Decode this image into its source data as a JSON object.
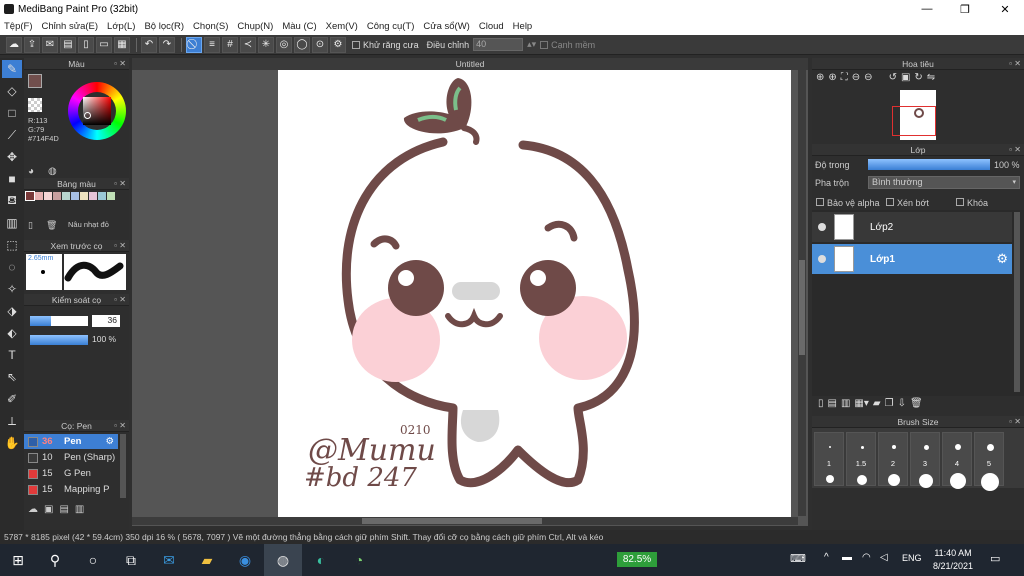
{
  "window": {
    "title": "MediBang Paint Pro (32bit)"
  },
  "menu": [
    "Tệp(F)",
    "Chỉnh sửa(E)",
    "Lớp(L)",
    "Bộ lọc(R)",
    "Chọn(S)",
    "Chụp(N)",
    "Màu (C)",
    "Xem(V)",
    "Công cụ(T)",
    "Cửa sổ(W)",
    "Cloud",
    "Help"
  ],
  "toolbar": {
    "antialias_label": "Khử răng cưa",
    "adjust_label": "Điều chỉnh",
    "adjust_value": "40",
    "edge_label": "Cạnh mềm"
  },
  "color_panel": {
    "title": "Màu",
    "r": "R:113",
    "g": "G:79",
    "hex": "#714F4D",
    "current_color": "#714f4d"
  },
  "palette_panel": {
    "title": "Bảng màu",
    "swatches": [
      "#7a3a3a",
      "#e9b3b3",
      "#f7d6d6",
      "#c9a0a0",
      "#b9d6cf",
      "#a7c0e6",
      "#efe3c0",
      "#e6c5d8",
      "#9bc9d6",
      "#c0e0b6"
    ],
    "selected_name": "Nâu nhạt đỏ"
  },
  "brush_preview": {
    "title": "Xem trước cọ",
    "size": "2.65mm"
  },
  "brush_control": {
    "title": "Kiểm soát cọ",
    "size": "36",
    "opacity": "100 %",
    "size_fraction": 0.36,
    "opacity_fraction": 1.0
  },
  "brush_list": {
    "title": "Cọ: Pen",
    "items": [
      {
        "size": "36",
        "name": "Pen",
        "color": "#3a7fd4",
        "selected": true
      },
      {
        "size": "10",
        "name": "Pen (Sharp)",
        "color": "#3a3a3a",
        "selected": false
      },
      {
        "size": "15",
        "name": "G Pen",
        "color": "#e03a3a",
        "selected": false
      },
      {
        "size": "15",
        "name": "Mapping P",
        "color": "#e03a3a",
        "selected": false
      }
    ]
  },
  "canvas": {
    "tab": "Untitled",
    "signature_line1": "@Mumu",
    "signature_line2": "#bd 247",
    "signature_note": "0210"
  },
  "navigator": {
    "title": "Hoa tiêu"
  },
  "layer_panel": {
    "title": "Lớp",
    "opacity_label": "Độ trong",
    "opacity_value": "100 %",
    "opacity_fraction": 1.0,
    "blend_label": "Pha trộn",
    "blend_value": "Bình thường",
    "protect_alpha": "Bảo vệ alpha",
    "clipping": "Xén bớt",
    "lock": "Khóa",
    "layers": [
      {
        "name": "Lớp2",
        "selected": false
      },
      {
        "name": "Lớp1",
        "selected": true
      }
    ]
  },
  "brush_size_panel": {
    "title": "Brush Size",
    "sizes": [
      "1",
      "1.5",
      "2",
      "3",
      "4",
      "5"
    ]
  },
  "status": {
    "text": "5787 * 8185 pixel  (42 * 59.4cm)  350 dpi   16 %   ( 5678, 7097 )   Vẽ một đường thẳng bằng cách giữ phím Shift. Thay đổi cỡ cọ bằng cách giữ phím Ctrl, Alt và kéo"
  },
  "taskbar": {
    "battery": "82.5%",
    "lang": "ENG",
    "time": "11:40 AM",
    "date": "8/21/2021"
  }
}
